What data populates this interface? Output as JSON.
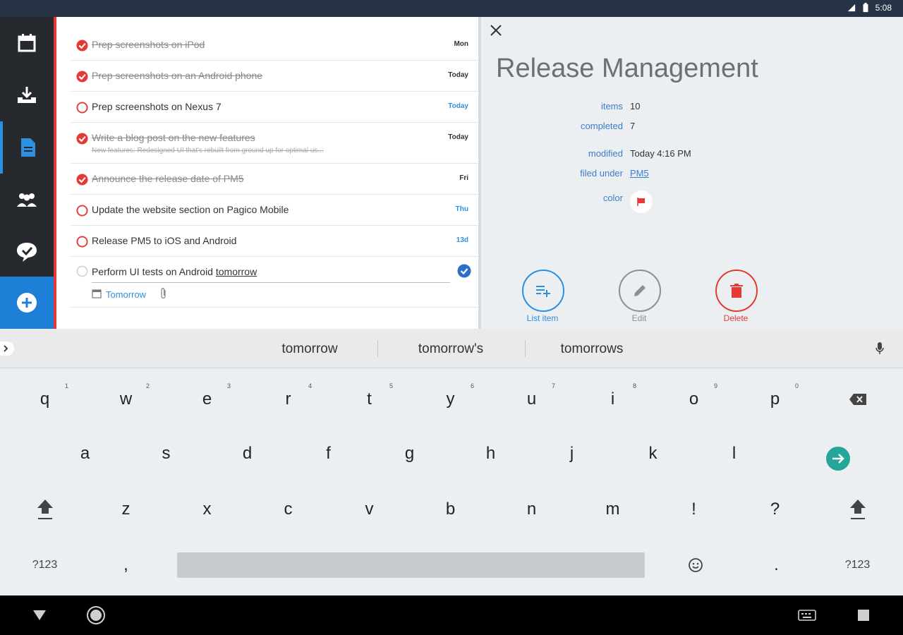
{
  "status": {
    "time": "5:08"
  },
  "list": {
    "rows": [
      {
        "title": "Prep screenshots on iPod",
        "due": "Mon",
        "done": true,
        "blue": false,
        "note": ""
      },
      {
        "title": "Prep screenshots on an Android phone",
        "due": "Today",
        "done": true,
        "blue": false,
        "note": ""
      },
      {
        "title": "Prep screenshots on Nexus 7",
        "due": "Today",
        "done": false,
        "blue": true,
        "note": ""
      },
      {
        "title": "Write a blog post on the new features",
        "due": "Today",
        "done": true,
        "blue": false,
        "note": "New features: Redesigned UI that's rebuilt from ground up for optimal us..."
      },
      {
        "title": "Announce the release date of PM5",
        "due": "Fri",
        "done": true,
        "blue": false,
        "note": ""
      },
      {
        "title": "Update the website section on Pagico Mobile",
        "due": "Thu",
        "done": false,
        "blue": true,
        "note": ""
      },
      {
        "title": "Release PM5 to iOS and Android",
        "due": "13d",
        "done": false,
        "blue": true,
        "note": ""
      }
    ],
    "editing": {
      "text_prefix": "Perform UI tests on Android ",
      "text_underlined": "tomorrow",
      "date_label": "Tomorrow"
    }
  },
  "detail": {
    "title": "Release Management",
    "fields": [
      {
        "label": "items",
        "value": "10"
      },
      {
        "label": "completed",
        "value": "7"
      },
      {
        "label": "modified",
        "value": "Today 4:16 PM"
      },
      {
        "label": "filed under",
        "value": "PM5"
      },
      {
        "label": "color",
        "value": ""
      }
    ],
    "actions": [
      {
        "label": "List item",
        "color": "#2c8fe0"
      },
      {
        "label": "Edit",
        "color": "#8a8f94"
      },
      {
        "label": "Delete",
        "color": "#e53935"
      }
    ]
  },
  "keyboard": {
    "suggestions": [
      "tomorrow",
      "tomorrow's",
      "tomorrows"
    ],
    "row1": [
      "q",
      "w",
      "e",
      "r",
      "t",
      "y",
      "u",
      "i",
      "o",
      "p"
    ],
    "row1_hints": [
      "1",
      "2",
      "3",
      "4",
      "5",
      "6",
      "7",
      "8",
      "9",
      "0"
    ],
    "row2": [
      "a",
      "s",
      "d",
      "f",
      "g",
      "h",
      "j",
      "k",
      "l"
    ],
    "row3": [
      "z",
      "x",
      "c",
      "v",
      "b",
      "n",
      "m",
      "!",
      "?"
    ],
    "row4": {
      "left": "?123",
      "comma": ",",
      "period": ".",
      "right": "?123"
    }
  },
  "colors": {
    "accent": "#2c8fe0",
    "red": "#e53935",
    "teal": "#26a69a"
  }
}
